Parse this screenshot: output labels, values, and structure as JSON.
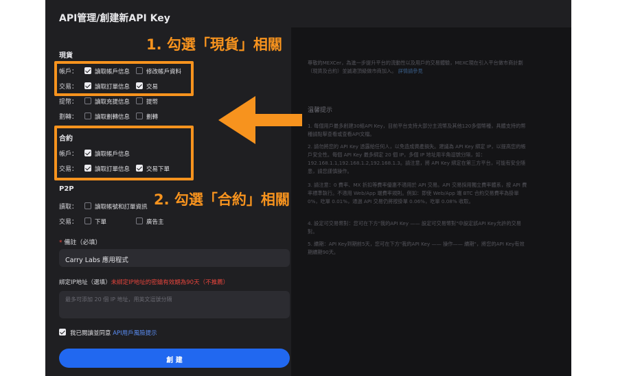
{
  "page": {
    "title": "API管理/創建新API Key"
  },
  "spot": {
    "title": "現貨",
    "rows": [
      {
        "label": "帳戶：",
        "options": [
          {
            "label": "讀取帳戶信息",
            "checked": true
          },
          {
            "label": "修改帳戶資料",
            "checked": false
          }
        ]
      },
      {
        "label": "交易：",
        "options": [
          {
            "label": "讀取訂單信息",
            "checked": true
          },
          {
            "label": "交易",
            "checked": true
          }
        ]
      },
      {
        "label": "提幣：",
        "options": [
          {
            "label": "讀取充提信息",
            "checked": false
          },
          {
            "label": "提幣",
            "checked": false
          }
        ]
      },
      {
        "label": "劃轉：",
        "options": [
          {
            "label": "讀取劃轉信息",
            "checked": false
          },
          {
            "label": "劃轉",
            "checked": false
          }
        ]
      }
    ]
  },
  "futures": {
    "title": "合約",
    "rows": [
      {
        "label": "帳戶：",
        "options": [
          {
            "label": "讀取帳戶信息",
            "checked": true
          }
        ]
      },
      {
        "label": "交易：",
        "options": [
          {
            "label": "讀取訂單信息",
            "checked": true
          },
          {
            "label": "交易下單",
            "checked": true
          }
        ]
      }
    ]
  },
  "p2p": {
    "title": "P2P",
    "rows": [
      {
        "label": "讀取：",
        "options": [
          {
            "label": "讀取帳號和訂單資訊",
            "checked": false
          }
        ]
      },
      {
        "label": "交易：",
        "options": [
          {
            "label": "下單",
            "checked": false
          },
          {
            "label": "廣告主",
            "checked": false
          }
        ]
      }
    ]
  },
  "note": {
    "required_mark": "*",
    "label": "備註（必填）",
    "value": "Carry Labs 應用程式"
  },
  "ip": {
    "label": "綁定IP地址（選填）",
    "warning": "未綁定IP地址的密鑰有效期為90天（不推薦）",
    "placeholder": "最多可添加 20 個 IP 地址，用英文逗號分隔"
  },
  "agreement": {
    "checked": true,
    "text": "我已閱讀並同意",
    "link": "API用戶風險提示"
  },
  "create_button": {
    "label": "創 建"
  },
  "annotations": {
    "step1": "1. 勾選「現貨」相關",
    "step2": "2. 勾選「合約」相關",
    "color": "#f7931e"
  },
  "right_panel": {
    "intro": "尊敬的MEXCer，為進一步提升平台的流動性以及用戶的交易體驗，MEXC現在引入平台做市商計劃（現貨及合約）並誠邀頂級做市商加入。",
    "intro_link": "詳情請參見",
    "tips_title": "溫馨提示",
    "tips": [
      "1. 每個用戶最多創建30組API Key，目前平台支持大部分主流幣及其他120多個幣種，具體支持的幣種請點擊查看或查看API文檔。",
      "2. 請勿將您的 API Key 透露給任何人，以免造成資產損失。建議為 API Key 綁定 IP，以提高您的帳戶安全性。每個 API Key 最多綁定 20 個 IP，多個 IP 地址用半角逗號分隔，如：192.168.1.1,192.168.1.2,192.168.1.3。請注意，將 API Key 綁定在第三方平台，可能有安全隱患，請您謹慎操作。",
      "3. 請注意：0 費率、MX 折扣等費率優惠不適用於 API 交易。API 交易採用獨立費率體系，按 API 費率標準執行。不適用 Web/App 端費率規則。例如：即使 Web/App 端 BTC 合約交易費率為掛單 0%，吃單 0.01%，通過 API 交易仍將按掛單 0.06%，吃單 0.08% 收取。",
      "4. 設定可交易幣對：您可在下方\"我的API Key —— 設定可交易幣對\"中設定該API Key允許的交易對。",
      "5. 續期：API Key到期前5天，您可在下方\"我的API Key —— 操作—— 續期\"，將您的API Key有效期續期90天。"
    ]
  }
}
